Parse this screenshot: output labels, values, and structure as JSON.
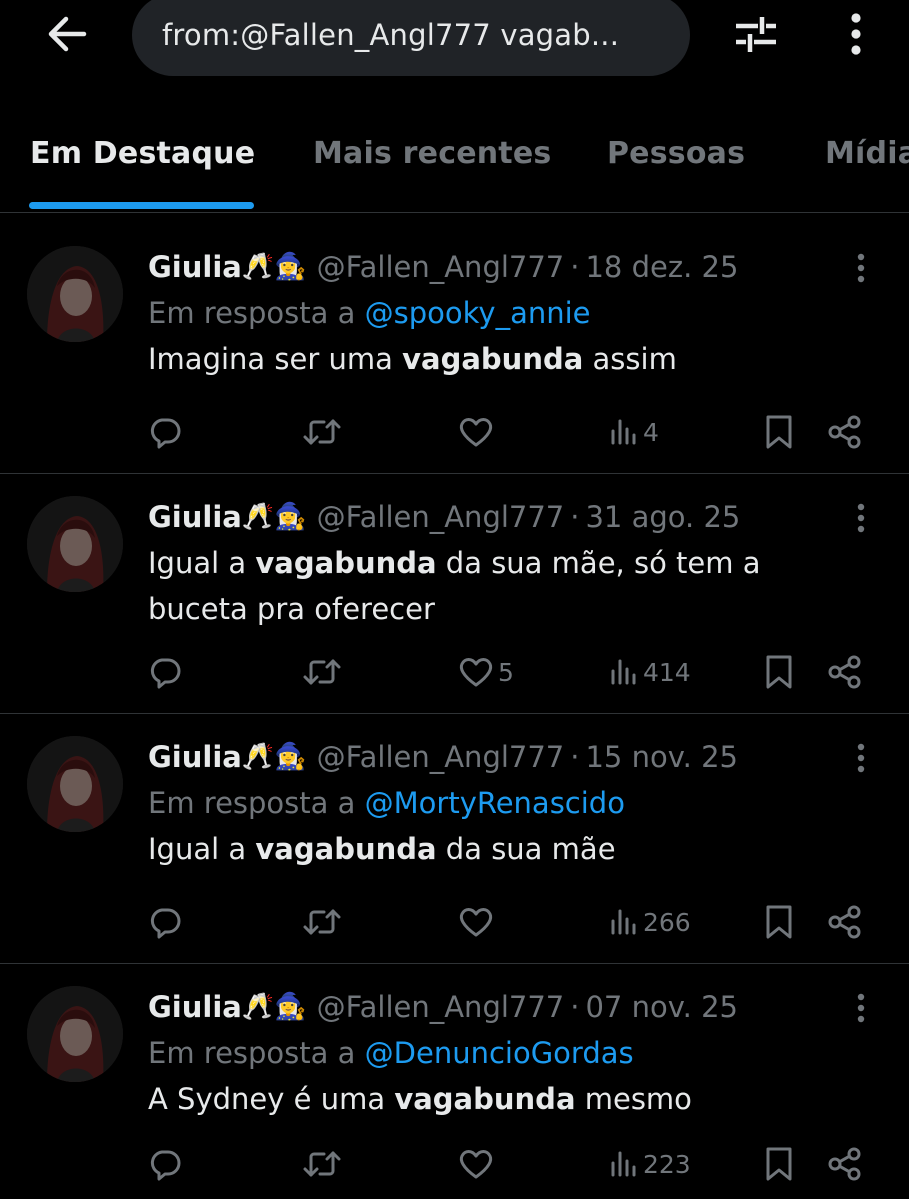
{
  "search": {
    "query": "from:@Fallen_Angl777 vagab..."
  },
  "tabs": [
    {
      "label": "Em Destaque"
    },
    {
      "label": "Mais recentes"
    },
    {
      "label": "Pessoas"
    },
    {
      "label": "Mídia"
    }
  ],
  "tweets": [
    {
      "name": "Giulia",
      "emoji": "🥂🧙‍♀️",
      "handle": "@Fallen_Angl777",
      "date": "18 dez. 25",
      "reply_prefix": "Em resposta a",
      "reply_to": "@spooky_annie",
      "text_before": "Imagina ser uma ",
      "text_bold": "vagabunda",
      "text_after": " assim",
      "likes": "",
      "views": "4"
    },
    {
      "name": "Giulia",
      "emoji": "🥂🧙‍♀️",
      "handle": "@Fallen_Angl777",
      "date": "31 ago. 25",
      "reply_prefix": "",
      "reply_to": "",
      "text_before": "Igual a ",
      "text_bold": "vagabunda",
      "text_after": " da sua mãe, só tem a buceta pra oferecer",
      "likes": "5",
      "views": "414"
    },
    {
      "name": "Giulia",
      "emoji": "🥂🧙‍♀️",
      "handle": "@Fallen_Angl777",
      "date": "15 nov. 25",
      "reply_prefix": "Em resposta a",
      "reply_to": "@MortyRenascido",
      "text_before": "Igual a ",
      "text_bold": "vagabunda",
      "text_after": " da sua mãe",
      "likes": "",
      "views": "266"
    },
    {
      "name": "Giulia",
      "emoji": "🥂🧙‍♀️",
      "handle": "@Fallen_Angl777",
      "date": "07 nov. 25",
      "reply_prefix": "Em resposta a",
      "reply_to": "@DenuncioGordas",
      "text_before": "A Sydney é uma ",
      "text_bold": "vagabunda",
      "text_after": " mesmo",
      "likes": "",
      "views": "223"
    }
  ],
  "colors": {
    "background": "#000000",
    "accent": "#1d9bf0",
    "text": "#e7e9ea",
    "muted": "#71767b",
    "divider": "#2f3336"
  }
}
